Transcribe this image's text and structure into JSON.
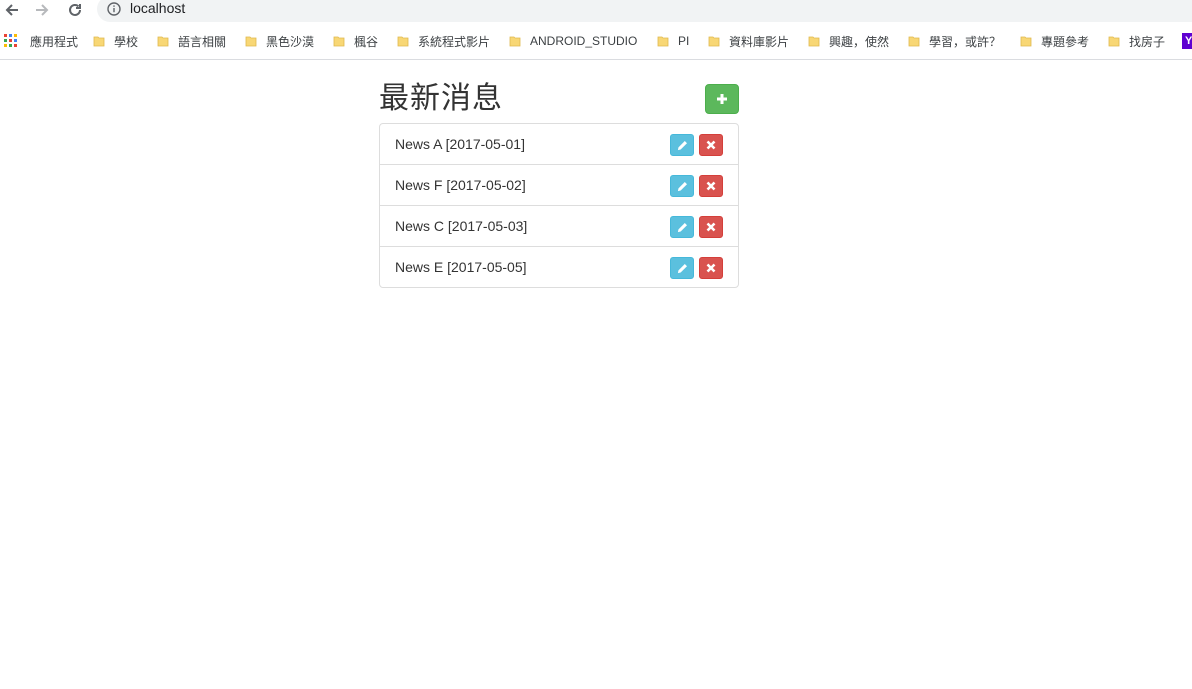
{
  "browser": {
    "url": "localhost",
    "bookmarks": [
      {
        "label": "應用程式",
        "icon": "apps-grid-icon"
      },
      {
        "label": "學校",
        "icon": "folder-icon"
      },
      {
        "label": "語言相關",
        "icon": "folder-icon"
      },
      {
        "label": "黑色沙漠",
        "icon": "folder-icon"
      },
      {
        "label": "楓谷",
        "icon": "folder-icon"
      },
      {
        "label": "系統程式影片",
        "icon": "folder-icon"
      },
      {
        "label": "ANDROID_STUDIO",
        "icon": "folder-icon"
      },
      {
        "label": "PI",
        "icon": "folder-icon"
      },
      {
        "label": "資料庫影片",
        "icon": "folder-icon"
      },
      {
        "label": "興趣，使然",
        "icon": "folder-icon"
      },
      {
        "label": "學習，或許？",
        "icon": "folder-icon"
      },
      {
        "label": "專題參考",
        "icon": "folder-icon"
      },
      {
        "label": "找房子",
        "icon": "folder-icon"
      }
    ],
    "yahoo_label": "Y"
  },
  "page": {
    "title": "最新消息",
    "add_icon": "plus-icon",
    "news": [
      {
        "label": "News A [2017-05-01]"
      },
      {
        "label": "News F [2017-05-02]"
      },
      {
        "label": "News C [2017-05-03]"
      },
      {
        "label": "News E [2017-05-05]"
      }
    ],
    "edit_icon": "pencil-icon",
    "delete_icon": "remove-icon"
  },
  "colors": {
    "success": "#5cb85c",
    "info": "#5bc0de",
    "danger": "#d9534f",
    "folder": "#f8d775"
  }
}
